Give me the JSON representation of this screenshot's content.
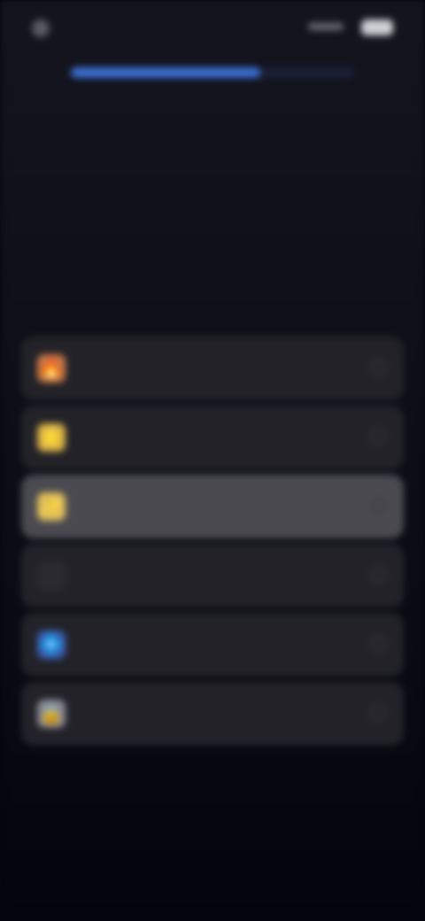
{
  "status_bar": {
    "time": "",
    "battery": ""
  },
  "progress": {
    "fraction": 0.67
  },
  "question": {
    "text": "",
    "hint": ""
  },
  "options": [
    {
      "icon": "flame-icon",
      "glyph": "🔥",
      "icon_color": "#c87a4a",
      "label": "",
      "selected": false
    },
    {
      "icon": "star-icon",
      "glyph": "⭐",
      "icon_color": "#d8b04a",
      "label": "",
      "selected": false
    },
    {
      "icon": "sparkle-icon",
      "glyph": "✨",
      "icon_color": "#e0c060",
      "label": "",
      "selected": true
    },
    {
      "icon": "blank-icon",
      "glyph": "",
      "icon_color": "#2a2a30",
      "label": "",
      "selected": false
    },
    {
      "icon": "diamond-icon",
      "glyph": "💠",
      "icon_color": "#3d5fb5",
      "label": "",
      "selected": false
    },
    {
      "icon": "lock-icon",
      "glyph": "🔒",
      "icon_color": "#8a8a94",
      "label": "",
      "selected": false
    }
  ],
  "colors": {
    "accent": "#3b6fd1",
    "background": "#14141f",
    "option_bg": "#222228",
    "option_selected_bg": "#4a4a50"
  }
}
